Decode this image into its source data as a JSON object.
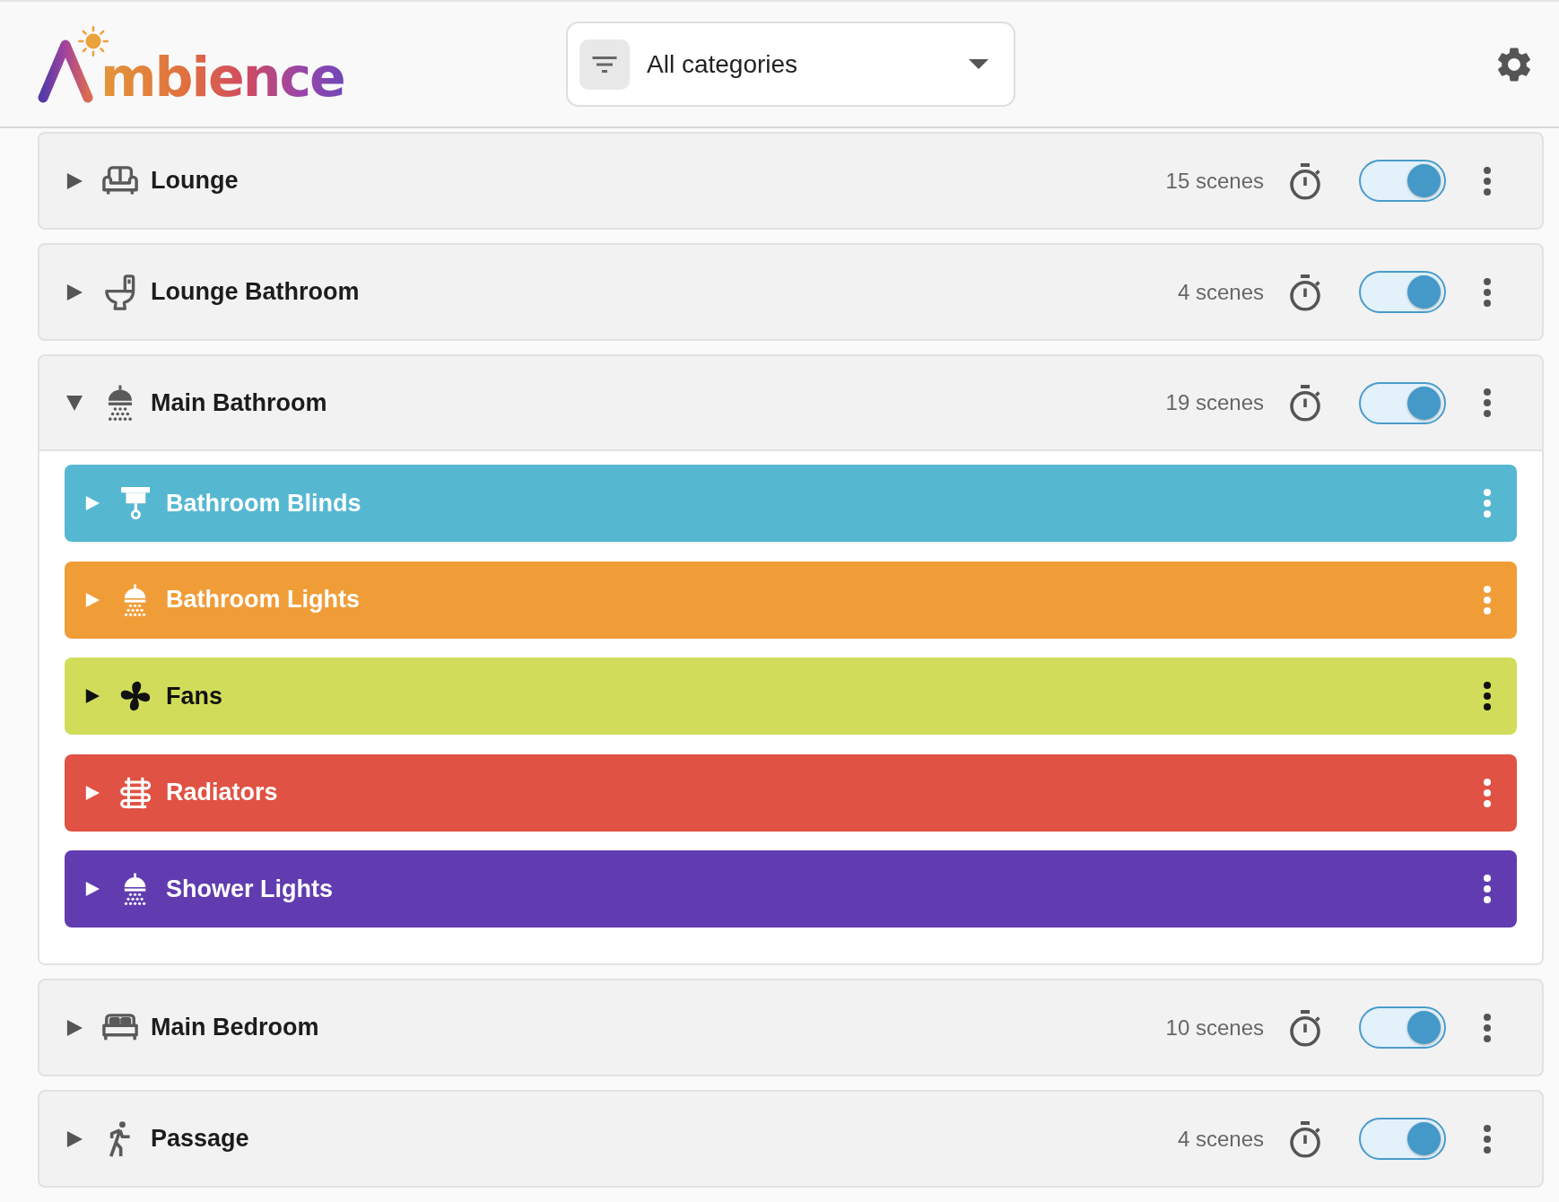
{
  "header": {
    "logo": {
      "text": "mbience"
    },
    "filter": {
      "value": "All categories"
    }
  },
  "rooms": [
    {
      "name": "Lounge",
      "kind": "sofa",
      "scenes": "15 scenes",
      "on": true,
      "expanded": false
    },
    {
      "name": "Lounge Bathroom",
      "kind": "toilet",
      "scenes": "4 scenes",
      "on": true,
      "expanded": false
    },
    {
      "name": "Main Bathroom",
      "kind": "shower",
      "scenes": "19 scenes",
      "on": true,
      "expanded": true,
      "children": [
        {
          "name": "Bathroom Blinds",
          "kind": "blinds",
          "color": "#56b7d1",
          "expanded": false
        },
        {
          "name": "Bathroom Lights",
          "kind": "shower",
          "color": "#f09d38",
          "expanded": false
        },
        {
          "name": "Fans",
          "kind": "fan",
          "color": "#d1dd5a",
          "expanded": false
        },
        {
          "name": "Radiators",
          "kind": "radiator",
          "color": "#e05243",
          "expanded": false
        },
        {
          "name": "Shower Lights",
          "kind": "shower",
          "color": "#613cb0",
          "expanded": false
        }
      ]
    },
    {
      "name": "Main Bedroom",
      "kind": "bed",
      "scenes": "10 scenes",
      "on": true,
      "expanded": false
    },
    {
      "name": "Passage",
      "kind": "walker",
      "scenes": "4 scenes",
      "on": true,
      "expanded": false
    }
  ]
}
